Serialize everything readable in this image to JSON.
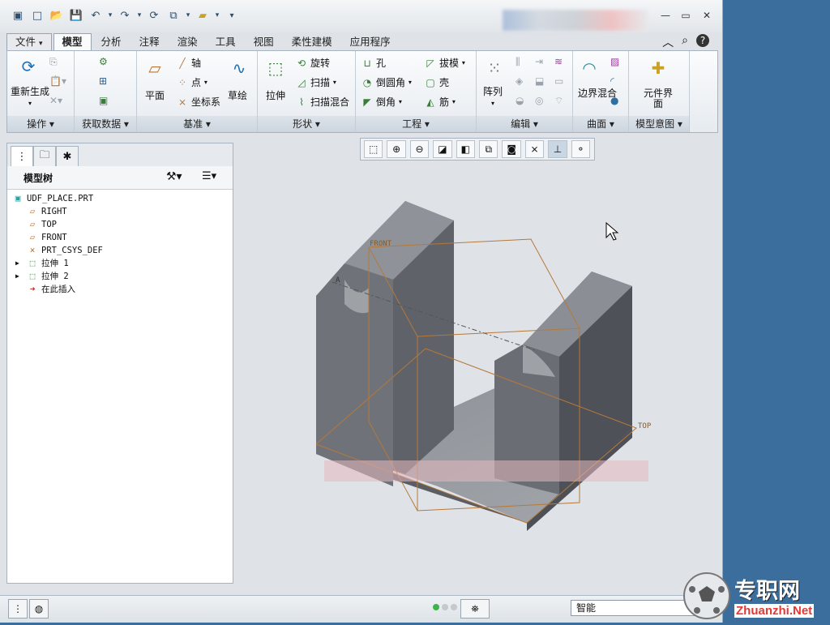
{
  "quick_access": {
    "icons": [
      "window-icon",
      "new-icon",
      "open-icon",
      "save-icon",
      "undo-icon",
      "redo-icon",
      "regenerate-icon",
      "windows-icon",
      "folder-icon",
      "customize-icon"
    ]
  },
  "tabs": [
    {
      "label": "文件",
      "arrow": "▾"
    },
    {
      "label": "模型"
    },
    {
      "label": "分析"
    },
    {
      "label": "注释"
    },
    {
      "label": "渲染"
    },
    {
      "label": "工具"
    },
    {
      "label": "视图"
    },
    {
      "label": "柔性建模"
    },
    {
      "label": "应用程序"
    }
  ],
  "ribbon": {
    "groups": {
      "operations": {
        "label": "操作",
        "regenerate": "重新生成"
      },
      "get_data": {
        "label": "获取数据"
      },
      "datum": {
        "label": "基准",
        "plane": "平面",
        "axis": "轴",
        "point": "点",
        "csys": "坐标系",
        "sketch": "草绘"
      },
      "shapes": {
        "label": "形状",
        "extrude": "拉伸",
        "revolve": "旋转",
        "sweep": "扫描",
        "swept_blend": "扫描混合"
      },
      "engineering": {
        "label": "工程",
        "hole": "孔",
        "draft": "拔模",
        "round": "倒圆角",
        "shell": "壳",
        "chamfer": "倒角",
        "rib": "筋"
      },
      "editing": {
        "label": "编辑",
        "pattern": "阵列"
      },
      "surfaces": {
        "label": "曲面",
        "boundary_blend": "边界混合"
      },
      "model_intent": {
        "label": "模型意图",
        "component_interface": "元件界面"
      }
    }
  },
  "panel": {
    "title": "模型树",
    "tree": [
      {
        "name": "UDF_PLACE.PRT",
        "icon": "part-icon",
        "expand": ""
      },
      {
        "name": "RIGHT",
        "icon": "datum-plane-icon",
        "expand": ""
      },
      {
        "name": "TOP",
        "icon": "datum-plane-icon",
        "expand": ""
      },
      {
        "name": "FRONT",
        "icon": "datum-plane-icon",
        "expand": ""
      },
      {
        "name": "PRT_CSYS_DEF",
        "icon": "csys-icon",
        "expand": ""
      },
      {
        "name": "拉伸 1",
        "icon": "extrude-icon",
        "expand": "▶"
      },
      {
        "name": "拉伸 2",
        "icon": "extrude-icon",
        "expand": "▶"
      },
      {
        "name": "在此插入",
        "icon": "insert-here-icon",
        "expand": ""
      }
    ]
  },
  "viewport": {
    "labels": {
      "front": "FRONT",
      "top": "TOP",
      "axis": "A"
    }
  },
  "statusbar": {
    "filter_value": "智能"
  },
  "watermark": {
    "text_cn": "专职网",
    "text_en": "Zhuanzhi.Net"
  },
  "colors": {
    "ribbon_bg": "#eef2f6",
    "model_gray": "#6f7379",
    "datum_orange": "#b5783a",
    "desktop_blue": "#3b6d9d"
  }
}
